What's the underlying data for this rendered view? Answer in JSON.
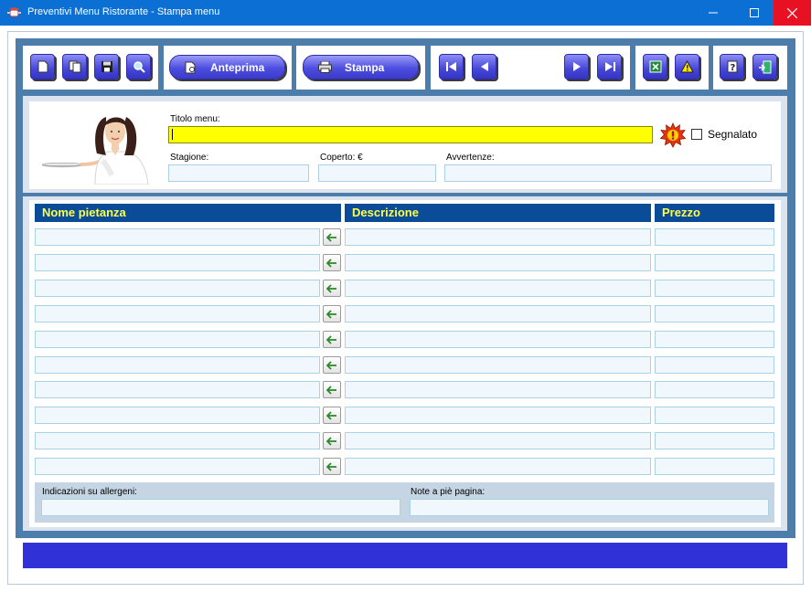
{
  "window": {
    "title": "Preventivi Menu Ristorante - Stampa menu",
    "min_symbol": "—",
    "max_symbol": "☐",
    "close_symbol": "✕"
  },
  "toolbar": {
    "file_buttons": [
      {
        "name": "new-document-button",
        "icon": "new-document-icon"
      },
      {
        "name": "copy-document-button",
        "icon": "copy-icon"
      },
      {
        "name": "save-button",
        "icon": "floppy-disk-icon"
      },
      {
        "name": "search-button",
        "icon": "magnifier-icon"
      }
    ],
    "preview_label": "Anteprima",
    "print_label": "Stampa",
    "nav_buttons": [
      "first-record",
      "previous-record",
      "next-record",
      "last-record"
    ],
    "tools_buttons": [
      "excel-export",
      "warning"
    ],
    "help_buttons": [
      "help",
      "exit"
    ]
  },
  "header": {
    "titolo_label": "Titolo menu:",
    "titolo_value": "",
    "segnalato_label": "Segnalato",
    "segnalato_checked": false,
    "stagione_label": "Stagione:",
    "stagione_value": "",
    "coperto_label": "Coperto: €",
    "coperto_value": "",
    "avvertenze_label": "Avvertenze:",
    "avvertenze_value": ""
  },
  "table": {
    "columns": [
      "Nome pietanza",
      "Descrizione",
      "Prezzo"
    ],
    "row_count": 10,
    "rows": [
      {
        "nome": "",
        "descrizione": "",
        "prezzo": ""
      },
      {
        "nome": "",
        "descrizione": "",
        "prezzo": ""
      },
      {
        "nome": "",
        "descrizione": "",
        "prezzo": ""
      },
      {
        "nome": "",
        "descrizione": "",
        "prezzo": ""
      },
      {
        "nome": "",
        "descrizione": "",
        "prezzo": ""
      },
      {
        "nome": "",
        "descrizione": "",
        "prezzo": ""
      },
      {
        "nome": "",
        "descrizione": "",
        "prezzo": ""
      },
      {
        "nome": "",
        "descrizione": "",
        "prezzo": ""
      },
      {
        "nome": "",
        "descrizione": "",
        "prezzo": ""
      },
      {
        "nome": "",
        "descrizione": "",
        "prezzo": ""
      }
    ]
  },
  "footer": {
    "allergeni_label": "Indicazioni su allergeni:",
    "allergeni_value": "",
    "note_label": "Note a piè pagina:",
    "note_value": ""
  },
  "status": {
    "text": ""
  },
  "colors": {
    "titlebar": "#0c6fd4",
    "close": "#e81123",
    "content_bg": "#4d7dab",
    "button": "#4646d8",
    "column_header": "#0b4c98",
    "column_header_text": "#ffff4c",
    "title_field": "#ffff00",
    "statusbar": "#3131d8"
  }
}
